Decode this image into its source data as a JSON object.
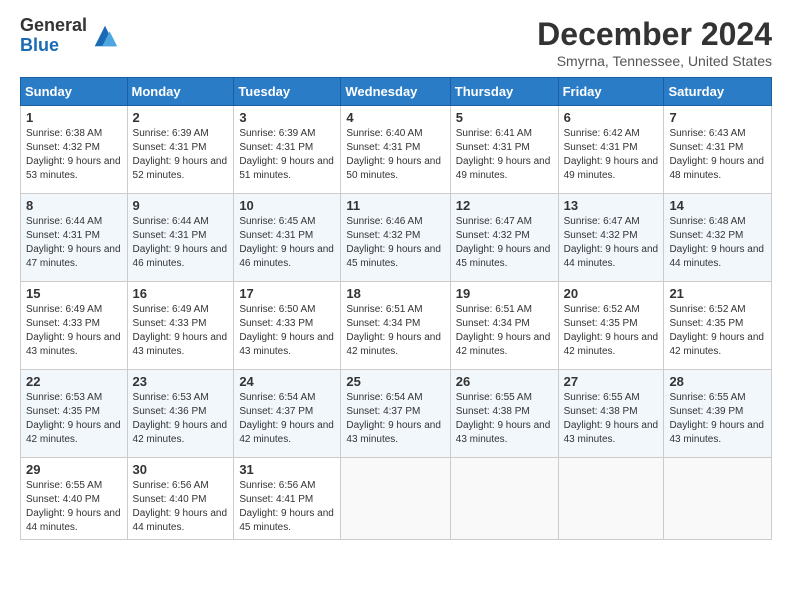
{
  "logo": {
    "general": "General",
    "blue": "Blue"
  },
  "title": "December 2024",
  "subtitle": "Smyrna, Tennessee, United States",
  "weekdays": [
    "Sunday",
    "Monday",
    "Tuesday",
    "Wednesday",
    "Thursday",
    "Friday",
    "Saturday"
  ],
  "weeks": [
    [
      {
        "day": "1",
        "sunrise": "6:38 AM",
        "sunset": "4:32 PM",
        "daylight": "9 hours and 53 minutes."
      },
      {
        "day": "2",
        "sunrise": "6:39 AM",
        "sunset": "4:31 PM",
        "daylight": "9 hours and 52 minutes."
      },
      {
        "day": "3",
        "sunrise": "6:39 AM",
        "sunset": "4:31 PM",
        "daylight": "9 hours and 51 minutes."
      },
      {
        "day": "4",
        "sunrise": "6:40 AM",
        "sunset": "4:31 PM",
        "daylight": "9 hours and 50 minutes."
      },
      {
        "day": "5",
        "sunrise": "6:41 AM",
        "sunset": "4:31 PM",
        "daylight": "9 hours and 49 minutes."
      },
      {
        "day": "6",
        "sunrise": "6:42 AM",
        "sunset": "4:31 PM",
        "daylight": "9 hours and 49 minutes."
      },
      {
        "day": "7",
        "sunrise": "6:43 AM",
        "sunset": "4:31 PM",
        "daylight": "9 hours and 48 minutes."
      }
    ],
    [
      {
        "day": "8",
        "sunrise": "6:44 AM",
        "sunset": "4:31 PM",
        "daylight": "9 hours and 47 minutes."
      },
      {
        "day": "9",
        "sunrise": "6:44 AM",
        "sunset": "4:31 PM",
        "daylight": "9 hours and 46 minutes."
      },
      {
        "day": "10",
        "sunrise": "6:45 AM",
        "sunset": "4:31 PM",
        "daylight": "9 hours and 46 minutes."
      },
      {
        "day": "11",
        "sunrise": "6:46 AM",
        "sunset": "4:32 PM",
        "daylight": "9 hours and 45 minutes."
      },
      {
        "day": "12",
        "sunrise": "6:47 AM",
        "sunset": "4:32 PM",
        "daylight": "9 hours and 45 minutes."
      },
      {
        "day": "13",
        "sunrise": "6:47 AM",
        "sunset": "4:32 PM",
        "daylight": "9 hours and 44 minutes."
      },
      {
        "day": "14",
        "sunrise": "6:48 AM",
        "sunset": "4:32 PM",
        "daylight": "9 hours and 44 minutes."
      }
    ],
    [
      {
        "day": "15",
        "sunrise": "6:49 AM",
        "sunset": "4:33 PM",
        "daylight": "9 hours and 43 minutes."
      },
      {
        "day": "16",
        "sunrise": "6:49 AM",
        "sunset": "4:33 PM",
        "daylight": "9 hours and 43 minutes."
      },
      {
        "day": "17",
        "sunrise": "6:50 AM",
        "sunset": "4:33 PM",
        "daylight": "9 hours and 43 minutes."
      },
      {
        "day": "18",
        "sunrise": "6:51 AM",
        "sunset": "4:34 PM",
        "daylight": "9 hours and 42 minutes."
      },
      {
        "day": "19",
        "sunrise": "6:51 AM",
        "sunset": "4:34 PM",
        "daylight": "9 hours and 42 minutes."
      },
      {
        "day": "20",
        "sunrise": "6:52 AM",
        "sunset": "4:35 PM",
        "daylight": "9 hours and 42 minutes."
      },
      {
        "day": "21",
        "sunrise": "6:52 AM",
        "sunset": "4:35 PM",
        "daylight": "9 hours and 42 minutes."
      }
    ],
    [
      {
        "day": "22",
        "sunrise": "6:53 AM",
        "sunset": "4:35 PM",
        "daylight": "9 hours and 42 minutes."
      },
      {
        "day": "23",
        "sunrise": "6:53 AM",
        "sunset": "4:36 PM",
        "daylight": "9 hours and 42 minutes."
      },
      {
        "day": "24",
        "sunrise": "6:54 AM",
        "sunset": "4:37 PM",
        "daylight": "9 hours and 42 minutes."
      },
      {
        "day": "25",
        "sunrise": "6:54 AM",
        "sunset": "4:37 PM",
        "daylight": "9 hours and 43 minutes."
      },
      {
        "day": "26",
        "sunrise": "6:55 AM",
        "sunset": "4:38 PM",
        "daylight": "9 hours and 43 minutes."
      },
      {
        "day": "27",
        "sunrise": "6:55 AM",
        "sunset": "4:38 PM",
        "daylight": "9 hours and 43 minutes."
      },
      {
        "day": "28",
        "sunrise": "6:55 AM",
        "sunset": "4:39 PM",
        "daylight": "9 hours and 43 minutes."
      }
    ],
    [
      {
        "day": "29",
        "sunrise": "6:55 AM",
        "sunset": "4:40 PM",
        "daylight": "9 hours and 44 minutes."
      },
      {
        "day": "30",
        "sunrise": "6:56 AM",
        "sunset": "4:40 PM",
        "daylight": "9 hours and 44 minutes."
      },
      {
        "day": "31",
        "sunrise": "6:56 AM",
        "sunset": "4:41 PM",
        "daylight": "9 hours and 45 minutes."
      },
      null,
      null,
      null,
      null
    ]
  ],
  "labels": {
    "sunrise": "Sunrise:",
    "sunset": "Sunset:",
    "daylight": "Daylight:"
  }
}
